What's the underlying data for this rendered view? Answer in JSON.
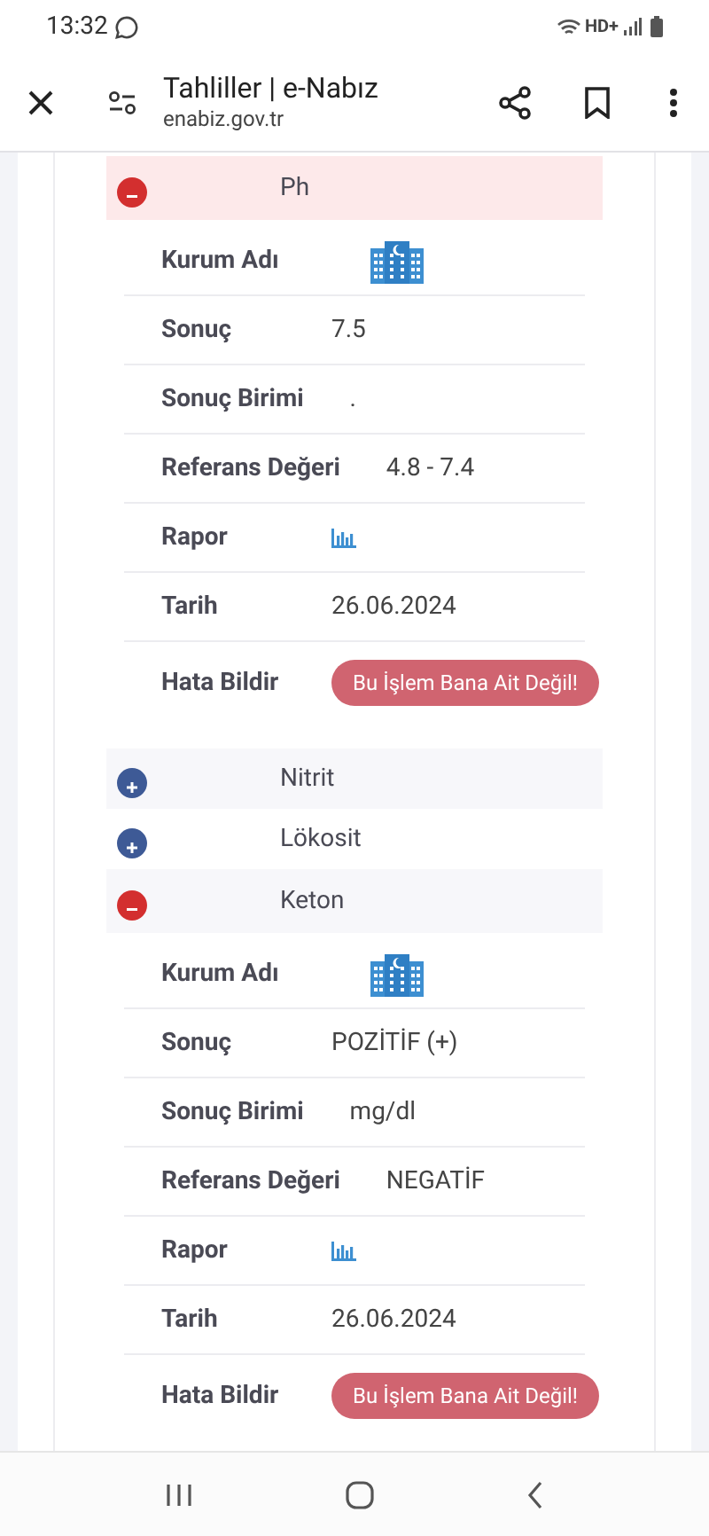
{
  "status_bar": {
    "time": "13:32",
    "network": "HD+"
  },
  "toolbar": {
    "title": "Tahliller | e-Nabız",
    "url": "enabiz.gov.tr"
  },
  "tests": [
    {
      "name": "Ph",
      "expanded": true,
      "selected": true,
      "details": [
        {
          "kind": "institution",
          "label": "Kurum Adı"
        },
        {
          "kind": "text",
          "label": "Sonuç",
          "value": "7.5"
        },
        {
          "kind": "text",
          "label": "Sonuç Birimi",
          "value": "."
        },
        {
          "kind": "text",
          "label": "Referans Değeri",
          "value": "4.8 - 7.4"
        },
        {
          "kind": "report",
          "label": "Rapor"
        },
        {
          "kind": "text",
          "label": "Tarih",
          "value": "26.06.2024"
        },
        {
          "kind": "button",
          "label": "Hata Bildir",
          "value": "Bu İşlem Bana Ait Değil!"
        }
      ]
    },
    {
      "name": "Nitrit",
      "expanded": false,
      "selected": false
    },
    {
      "name": "Lökosit",
      "expanded": false,
      "selected": false
    },
    {
      "name": "Keton",
      "expanded": true,
      "selected": false,
      "details": [
        {
          "kind": "institution",
          "label": "Kurum Adı"
        },
        {
          "kind": "text",
          "label": "Sonuç",
          "value": "POZİTİF (+)"
        },
        {
          "kind": "text",
          "label": "Sonuç Birimi",
          "value": "mg/dl"
        },
        {
          "kind": "text",
          "label": "Referans Değeri",
          "value": "NEGATİF"
        },
        {
          "kind": "report",
          "label": "Rapor"
        },
        {
          "kind": "text",
          "label": "Tarih",
          "value": "26.06.2024"
        },
        {
          "kind": "button",
          "label": "Hata Bildir",
          "value": "Bu İşlem Bana Ait Değil!"
        }
      ]
    }
  ]
}
